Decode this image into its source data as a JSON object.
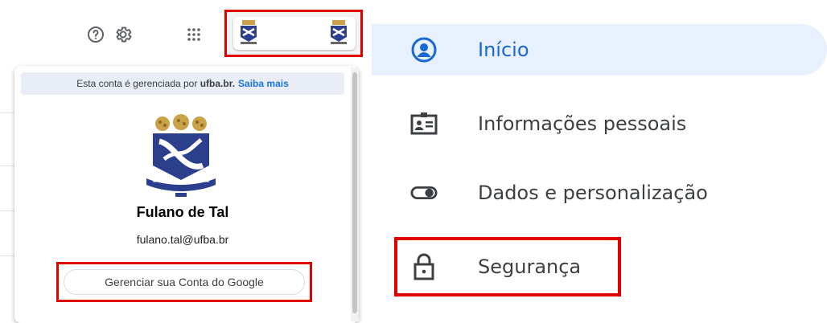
{
  "header": {
    "help_icon": "help-circle-icon",
    "settings_icon": "gear-icon",
    "apps_icon": "apps-grid-icon"
  },
  "account_popup": {
    "managed_prefix": "Esta conta é gerenciada por",
    "managed_domain": "ufba.br.",
    "learn_more": "Saiba mais",
    "user_name": "Fulano de Tal",
    "user_email": "fulano.tal@ufba.br",
    "manage_button": "Gerenciar sua Conta do Google"
  },
  "nav": {
    "items": [
      {
        "label": "Início",
        "icon": "person-circle-icon",
        "active": true
      },
      {
        "label": "Informações pessoais",
        "icon": "id-card-icon",
        "active": false
      },
      {
        "label": "Dados e personalização",
        "icon": "toggle-icon",
        "active": false
      },
      {
        "label": "Segurança",
        "icon": "lock-icon",
        "active": false
      }
    ]
  },
  "colors": {
    "highlight_border": "#e00000",
    "active_bg": "#e8f0fe",
    "active_text": "#1967d2",
    "link": "#1a73e8"
  }
}
